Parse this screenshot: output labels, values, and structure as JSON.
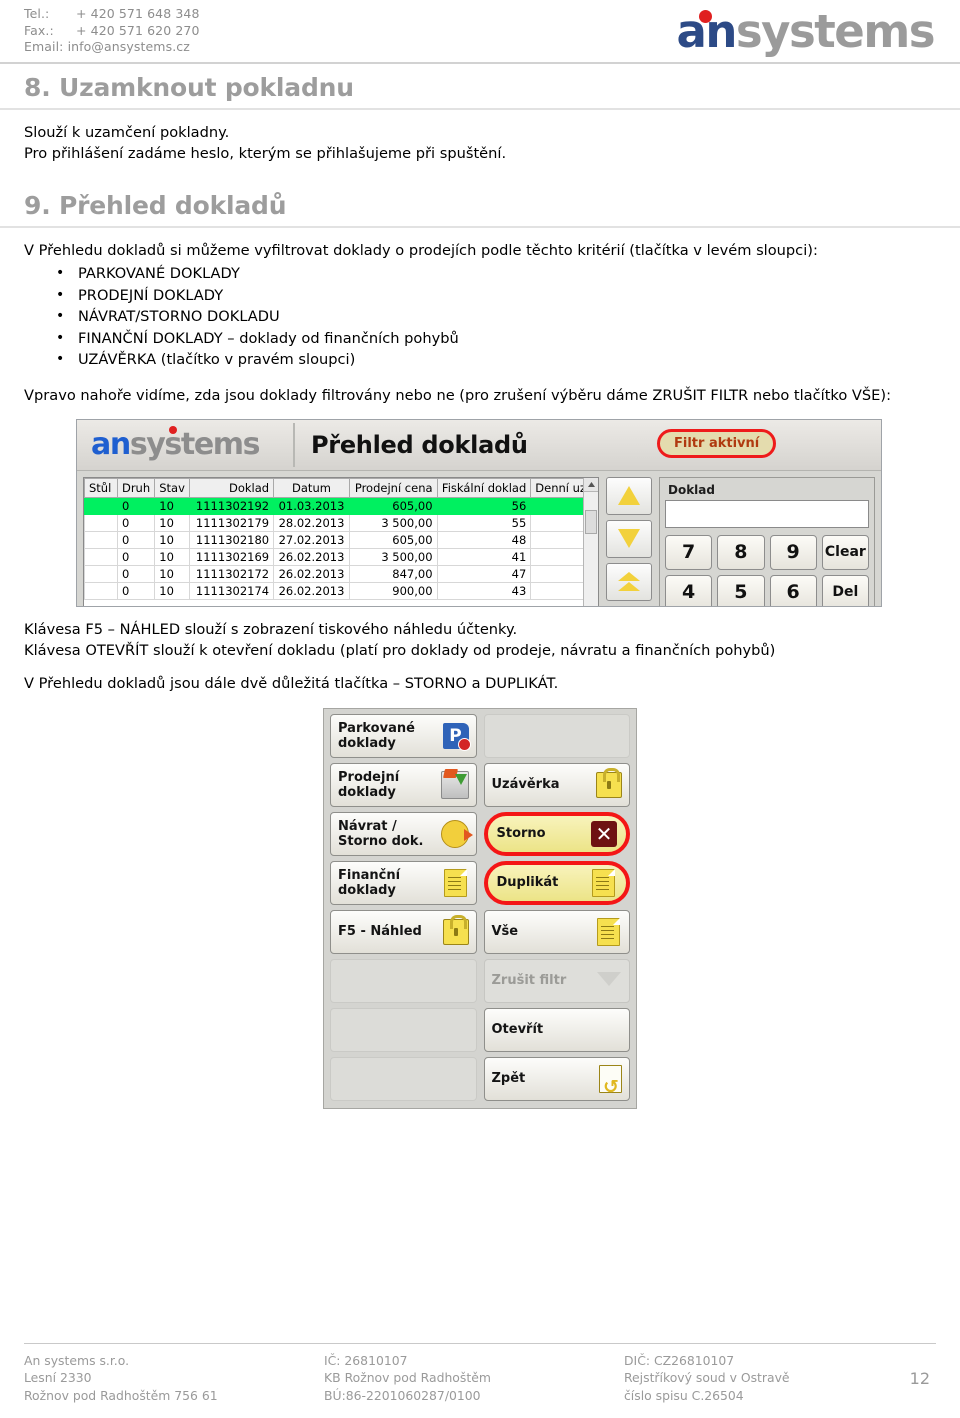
{
  "header": {
    "contact": {
      "tel_label": "Tel.:",
      "tel_value": "+ 420 571 648 348",
      "fax_label": "Fax.:",
      "fax_value": "+ 420 571 620 270",
      "email": "Email: info@ansystems.cz"
    },
    "logo": {
      "part1": "an",
      "part2": "systems"
    }
  },
  "sections": {
    "eight": {
      "heading": "8. Uzamknout pokladnu",
      "line1": "Slouží k uzamčení pokladny.",
      "line2": "Pro přihlášení zadáme heslo, kterým se přihlašujeme při spuštění."
    },
    "nine": {
      "heading": "9. Přehled dokladů",
      "intro": "V Přehledu dokladů si můžeme vyfiltrovat doklady o prodejích podle těchto kritérií (tlačítka v levém sloupci):",
      "criteria": [
        "PARKOVANÉ DOKLADY",
        "PRODEJNÍ DOKLADY",
        "NÁVRAT/STORNO DOKLADU",
        "FINANČNÍ DOKLADY – doklady od finančních pohybů",
        "UZÁVĚRKA (tlačítko v pravém sloupci)"
      ],
      "filter_note": "Vpravo nahoře vidíme, zda jsou doklady filtrovány nebo ne (pro zrušení výběru dáme ZRUŠIT FILTR nebo tlačítko VŠE):",
      "note_f5": "Klávesa F5 – NÁHLED slouží s zobrazení tiskového náhledu účtenky.",
      "note_open": "Klávesa OTEVŘÍT slouží k otevření dokladu (platí pro doklady od prodeje, návratu a finančních pohybů)",
      "note_buttons": "V Přehledu dokladů jsou dále dvě důležitá tlačítka – STORNO a DUPLIKÁT."
    }
  },
  "app_screenshot": {
    "logo": {
      "part1": "an",
      "part2": "systems"
    },
    "title": "Přehled dokladů",
    "filter_badge": "Filtr aktivní",
    "grid": {
      "columns": [
        "Stůl",
        "Druh",
        "Stav",
        "Doklad",
        "Datum",
        "Prodejní cena",
        "Fiskální doklad",
        "Denní uzá"
      ],
      "rows": [
        {
          "stul": "",
          "druh": "0",
          "stav": "10",
          "doklad": "1111302192",
          "datum": "01.03.2013",
          "cena": "605,00",
          "fiskal": "56",
          "denni": "",
          "selected": true
        },
        {
          "stul": "",
          "druh": "0",
          "stav": "10",
          "doklad": "1111302179",
          "datum": "28.02.2013",
          "cena": "3 500,00",
          "fiskal": "55",
          "denni": "",
          "selected": false
        },
        {
          "stul": "",
          "druh": "0",
          "stav": "10",
          "doklad": "1111302180",
          "datum": "27.02.2013",
          "cena": "605,00",
          "fiskal": "48",
          "denni": "",
          "selected": false
        },
        {
          "stul": "",
          "druh": "0",
          "stav": "10",
          "doklad": "1111302169",
          "datum": "26.02.2013",
          "cena": "3 500,00",
          "fiskal": "41",
          "denni": "",
          "selected": false
        },
        {
          "stul": "",
          "druh": "0",
          "stav": "10",
          "doklad": "1111302172",
          "datum": "26.02.2013",
          "cena": "847,00",
          "fiskal": "47",
          "denni": "",
          "selected": false
        },
        {
          "stul": "",
          "druh": "0",
          "stav": "10",
          "doklad": "1111302174",
          "datum": "26.02.2013",
          "cena": "900,00",
          "fiskal": "43",
          "denni": "",
          "selected": false
        }
      ]
    },
    "doklad_panel": {
      "label": "Doklad",
      "value": "",
      "keys": [
        "7",
        "8",
        "9",
        "Clear",
        "4",
        "5",
        "6",
        "Del"
      ]
    },
    "nav_arrows": [
      "arrow-up-icon",
      "arrow-down-icon",
      "arrow-double-up-icon"
    ],
    "colors": {
      "selected_row": "#00f060",
      "badge_border": "#f41616",
      "badge_bg": "#e4dcae",
      "badge_text": "#b03a10"
    }
  },
  "button_panel": {
    "left": [
      {
        "label": "Parkované\ndoklady",
        "icon": "parking-doc-icon",
        "state": "normal"
      },
      {
        "label": "Prodejní\ndoklady",
        "icon": "cash-register-icon",
        "state": "normal"
      },
      {
        "label": "Návrat /\nStorno dok.",
        "icon": "coins-return-icon",
        "state": "normal"
      },
      {
        "label": "Finanční\ndoklady",
        "icon": "document-icon",
        "state": "normal"
      },
      {
        "label": "F5 - Náhled",
        "icon": "lock-preview-icon",
        "state": "normal"
      },
      {
        "label": "",
        "icon": "",
        "state": "empty"
      },
      {
        "label": "",
        "icon": "",
        "state": "empty"
      },
      {
        "label": "",
        "icon": "",
        "state": "empty"
      }
    ],
    "right": [
      {
        "label": "",
        "icon": "",
        "state": "empty"
      },
      {
        "label": "Uzávěrka",
        "icon": "lock-icon",
        "state": "normal"
      },
      {
        "label": "Storno",
        "icon": "red-x-icon",
        "state": "highlight"
      },
      {
        "label": "Duplikát",
        "icon": "document-icon",
        "state": "highlight"
      },
      {
        "label": "Vše",
        "icon": "document-icon",
        "state": "normal"
      },
      {
        "label": "Zrušit filtr",
        "icon": "funnel-icon",
        "state": "disabled"
      },
      {
        "label": "Otevřít",
        "icon": "",
        "state": "normal"
      },
      {
        "label": "Zpět",
        "icon": "back-doc-icon",
        "state": "normal"
      }
    ]
  },
  "footer": {
    "col1": [
      "An systems s.r.o.",
      "Lesní 2330",
      "Rožnov pod Radhoštěm 756 61"
    ],
    "col2": [
      "IČ: 26810107",
      "KB Rožnov pod Radhoštěm",
      "BÚ:86-2201060287/0100"
    ],
    "col3": [
      "DIČ: CZ26810107",
      "Rejstříkový soud v Ostravě",
      "číslo spisu C.26504"
    ],
    "page_number": "12"
  }
}
